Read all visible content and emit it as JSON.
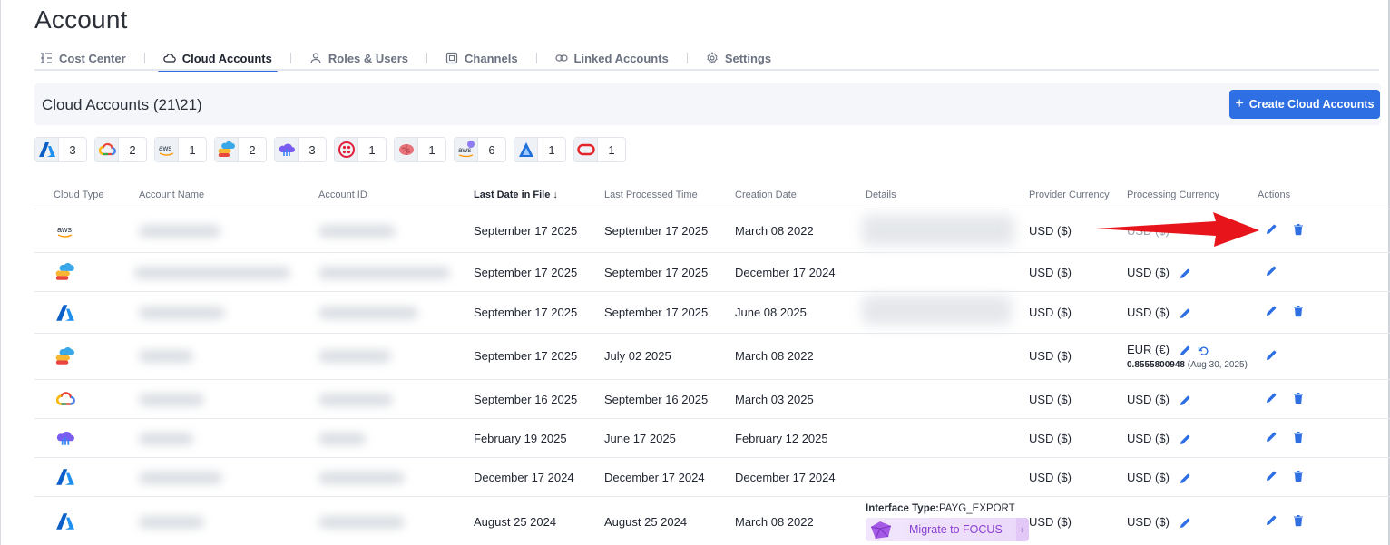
{
  "page_title": "Account",
  "tabs": [
    {
      "label": "Cost Center",
      "icon": "list-tree-icon",
      "active": false
    },
    {
      "label": "Cloud Accounts",
      "icon": "cloud-icon",
      "active": true
    },
    {
      "label": "Roles & Users",
      "icon": "user-icon",
      "active": false
    },
    {
      "label": "Channels",
      "icon": "channel-icon",
      "active": false
    },
    {
      "label": "Linked Accounts",
      "icon": "link-icon",
      "active": false
    },
    {
      "label": "Settings",
      "icon": "gear-icon",
      "active": false
    }
  ],
  "section": {
    "title": "Cloud Accounts (21\\21)",
    "create_button": "Create Cloud Accounts"
  },
  "provider_chips": [
    {
      "icon": "azure-icon",
      "count": "3"
    },
    {
      "icon": "gcp-icon",
      "count": "2"
    },
    {
      "icon": "aws-icon",
      "count": "1"
    },
    {
      "icon": "multicloud-icon",
      "count": "2"
    },
    {
      "icon": "purple-cloud-icon",
      "count": "3"
    },
    {
      "icon": "twilio-icon",
      "count": "1"
    },
    {
      "icon": "brain-icon",
      "count": "1"
    },
    {
      "icon": "aws-badge-icon",
      "count": "6"
    },
    {
      "icon": "azure-alt-icon",
      "count": "1"
    },
    {
      "icon": "oracle-icon",
      "count": "1"
    }
  ],
  "table": {
    "columns": [
      "Cloud Type",
      "Account Name",
      "Account ID",
      "Last Date in File",
      "Last Processed Time",
      "Creation Date",
      "Details",
      "Provider Currency",
      "Processing Currency",
      "Actions"
    ],
    "rows": [
      {
        "cloud": "aws-icon",
        "last_date": "September 17 2025",
        "last_processed": "September 17 2025",
        "creation": "March 08 2022",
        "provider_currency": "USD ($)",
        "processing_currency": "USD ($)",
        "delete": true
      },
      {
        "cloud": "multicloud-icon",
        "last_date": "September 17 2025",
        "last_processed": "September 17 2025",
        "creation": "December 17 2024",
        "provider_currency": "USD ($)",
        "processing_currency": "USD ($)",
        "delete": false
      },
      {
        "cloud": "azure-icon",
        "last_date": "September 17 2025",
        "last_processed": "September 17 2025",
        "creation": "June 08 2025",
        "provider_currency": "USD ($)",
        "processing_currency": "USD ($)",
        "delete": true
      },
      {
        "cloud": "multicloud-icon",
        "last_date": "September 17 2025",
        "last_processed": "July 02 2025",
        "creation": "March 08 2022",
        "provider_currency": "USD ($)",
        "processing_currency": "EUR (€)",
        "rate_value": "0.8555800948",
        "rate_date": "(Aug 30, 2025)",
        "delete": false
      },
      {
        "cloud": "gcp-icon",
        "last_date": "September 16 2025",
        "last_processed": "September 16 2025",
        "creation": "March 03 2025",
        "provider_currency": "USD ($)",
        "processing_currency": "USD ($)",
        "delete": true
      },
      {
        "cloud": "purple-cloud-icon",
        "last_date": "February 19 2025",
        "last_processed": "June 17 2025",
        "creation": "February 12 2025",
        "provider_currency": "USD ($)",
        "processing_currency": "USD ($)",
        "delete": true
      },
      {
        "cloud": "azure-icon",
        "last_date": "December 17 2024",
        "last_processed": "December 17 2024",
        "creation": "December 17 2024",
        "provider_currency": "USD ($)",
        "processing_currency": "USD ($)",
        "delete": true
      },
      {
        "cloud": "azure-icon",
        "last_date": "August 25 2024",
        "last_processed": "August 25 2024",
        "creation": "March 08 2022",
        "provider_currency": "USD ($)",
        "processing_currency": "USD ($)",
        "delete": true,
        "interface_label": "Interface Type:",
        "interface_value": "PAYG_EXPORT",
        "migrate_label": "Migrate to FOCUS"
      }
    ]
  },
  "colors": {
    "accent": "#2f6fe4",
    "annotation_arrow": "#e8141b",
    "migrate_text": "#8a3fd1"
  }
}
